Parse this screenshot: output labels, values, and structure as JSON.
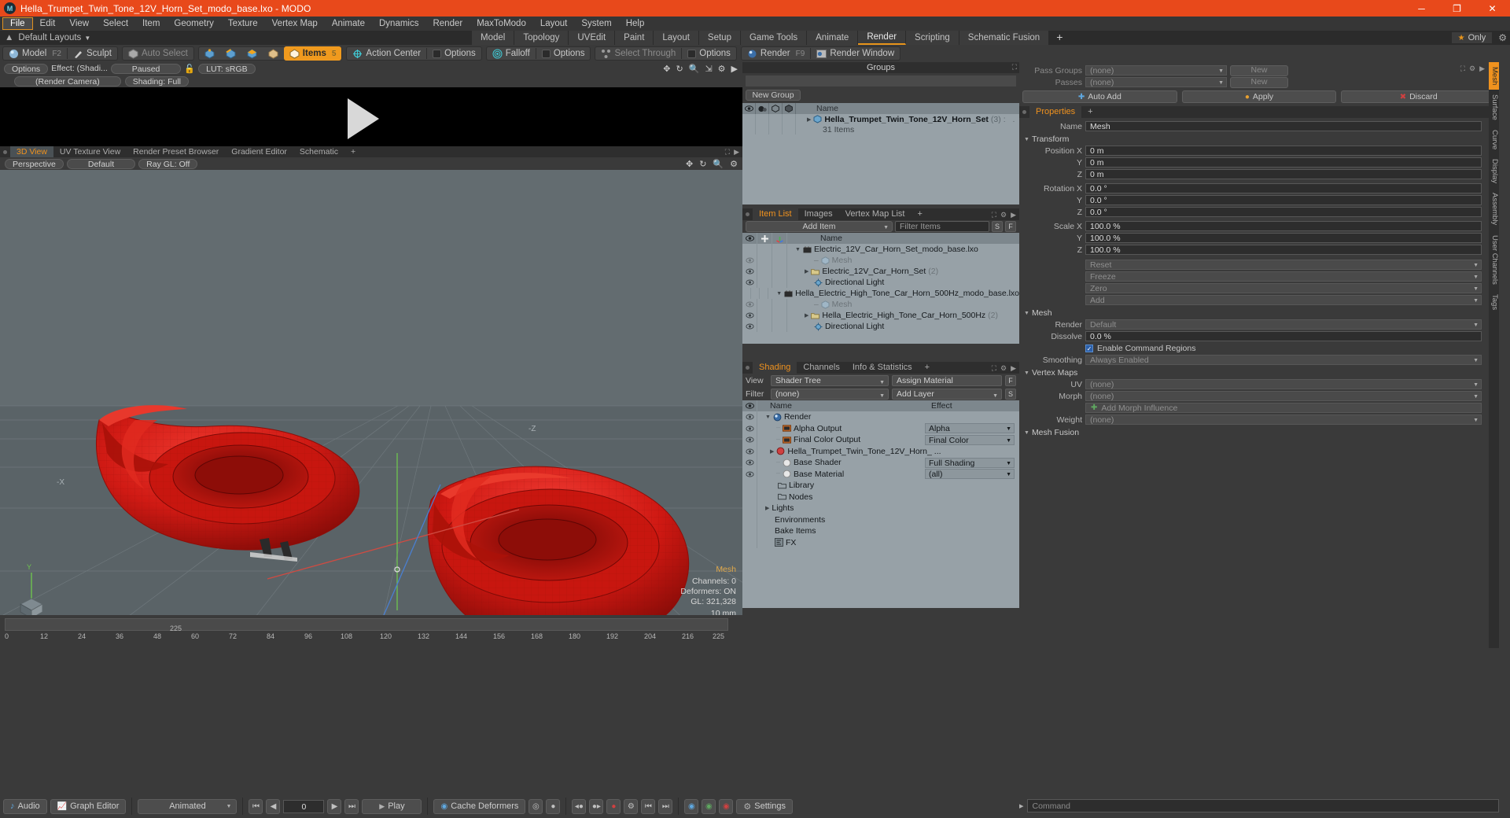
{
  "titlebar": {
    "title": "Hella_Trumpet_Twin_Tone_12V_Horn_Set_modo_base.lxo - MODO",
    "minimize": "─",
    "maximize": "❐",
    "close": "✕"
  },
  "menubar": {
    "items": [
      "File",
      "Edit",
      "View",
      "Select",
      "Item",
      "Geometry",
      "Texture",
      "Vertex Map",
      "Animate",
      "Dynamics",
      "Render",
      "MaxToModo",
      "Layout",
      "System",
      "Help"
    ],
    "active": "File"
  },
  "layoutbar": {
    "layouts_label": "Default Layouts",
    "tabs": [
      "Model",
      "Topology",
      "UVEdit",
      "Paint",
      "Layout",
      "Setup",
      "Game Tools",
      "Animate",
      "Render",
      "Scripting",
      "Schematic Fusion"
    ],
    "active_tab": "Render",
    "plus": "+",
    "only_label": "Only"
  },
  "modebar": {
    "model": "Model",
    "model_key": "F2",
    "sculpt": "Sculpt",
    "auto_select": "Auto Select",
    "items": "Items",
    "items_key": "5",
    "action_center": "Action Center",
    "options1": "Options",
    "falloff": "Falloff",
    "options2": "Options",
    "select_through": "Select Through",
    "options3": "Options",
    "render": "Render",
    "render_key": "F9",
    "render_window": "Render Window"
  },
  "render_view": {
    "options": "Options",
    "effect": "Effect: (Shadi...",
    "paused": "Paused",
    "lut": "LUT: sRGB",
    "camera": "(Render Camera)",
    "shading": "Shading: Full"
  },
  "view3d": {
    "tabs": [
      "3D View",
      "UV Texture View",
      "Render Preset Browser",
      "Gradient Editor",
      "Schematic"
    ],
    "active_tab": "3D View",
    "plus": "+",
    "perspective": "Perspective",
    "default": "Default",
    "raygl": "Ray GL: Off",
    "hud": {
      "title": "Mesh",
      "channels": "Channels: 0",
      "deformers": "Deformers: ON",
      "gl": "GL: 321,328",
      "unit": "10 mm"
    },
    "axis_labels": {
      "x": "-X",
      "y": "Y",
      "z": "-Z"
    }
  },
  "groups": {
    "title": "Groups",
    "new_group": "New Group",
    "columns": [
      "Name"
    ],
    "rows": [
      {
        "name": "Hella_Trumpet_Twin_Tone_12V_Horn_Set",
        "count": "(3)",
        "suffix": ":",
        "bold": true
      },
      {
        "name": "31 Items",
        "count": "",
        "suffix": "",
        "bold": false
      }
    ]
  },
  "itemlist": {
    "tabs": [
      "Item List",
      "Images",
      "Vertex Map List"
    ],
    "active_tab": "Item List",
    "plus": "+",
    "add_item": "Add Item",
    "filter_placeholder": "Filter Items",
    "btn_s": "S",
    "btn_f": "F",
    "columns": [
      "Name"
    ],
    "rows": [
      {
        "label": "Electric_12V_Car_Horn_Set_modo_base.lxo",
        "indent": 0,
        "icon": "scene-icon",
        "muted": false,
        "caret": "down"
      },
      {
        "label": "Mesh",
        "indent": 1,
        "icon": "mesh-icon",
        "muted": true,
        "caret": "none"
      },
      {
        "label": "Electric_12V_Car_Horn_Set",
        "indent": 1,
        "icon": "group-icon",
        "muted": false,
        "caret": "right",
        "count": "(2)"
      },
      {
        "label": "Directional Light",
        "indent": 1,
        "icon": "light-icon",
        "muted": false,
        "caret": "none"
      },
      {
        "label": "Hella_Electric_High_Tone_Car_Horn_500Hz_modo_base.lxo",
        "indent": 0,
        "icon": "scene-icon",
        "muted": false,
        "caret": "down"
      },
      {
        "label": "Mesh",
        "indent": 1,
        "icon": "mesh-icon",
        "muted": true,
        "caret": "none"
      },
      {
        "label": "Hella_Electric_High_Tone_Car_Horn_500Hz",
        "indent": 1,
        "icon": "group-icon",
        "muted": false,
        "caret": "right",
        "count": "(2)"
      },
      {
        "label": "Directional Light",
        "indent": 1,
        "icon": "light-icon",
        "muted": false,
        "caret": "none"
      }
    ]
  },
  "shading": {
    "tabs": [
      "Shading",
      "Channels",
      "Info & Statistics"
    ],
    "active_tab": "Shading",
    "plus": "+",
    "view_label": "View",
    "view_value": "Shader Tree",
    "assign_material": "Assign Material",
    "btn_f": "F",
    "filter_label": "Filter",
    "filter_value": "(none)",
    "add_layer": "Add Layer",
    "btn_s": "S",
    "col_name": "Name",
    "col_effect": "Effect",
    "rows": [
      {
        "label": "Render",
        "indent": 0,
        "effect": "",
        "icon": "render-icon",
        "caret": "down",
        "eye": true
      },
      {
        "label": "Alpha Output",
        "indent": 1,
        "effect": "Alpha",
        "icon": "output-icon",
        "caret": "none",
        "eye": true
      },
      {
        "label": "Final Color Output",
        "indent": 1,
        "effect": "Final Color",
        "icon": "output-icon",
        "caret": "none",
        "eye": true
      },
      {
        "label": "Hella_Trumpet_Twin_Tone_12V_Horn_ ...",
        "indent": 1,
        "effect": "",
        "icon": "material-icon",
        "caret": "right",
        "eye": true,
        "dotcolor": "#d04040"
      },
      {
        "label": "Base Shader",
        "indent": 1,
        "effect": "Full Shading",
        "icon": "shader-icon",
        "caret": "none",
        "eye": true
      },
      {
        "label": "Base Material",
        "indent": 1,
        "effect": "(all)",
        "icon": "shader-icon",
        "caret": "none",
        "eye": true
      },
      {
        "label": "Library",
        "indent": 1,
        "effect": "",
        "icon": "folder-icon",
        "caret": "none",
        "eye": false
      },
      {
        "label": "Nodes",
        "indent": 1,
        "effect": "",
        "icon": "folder-icon",
        "caret": "none",
        "eye": false
      },
      {
        "label": "Lights",
        "indent": 0,
        "effect": "",
        "icon": "none",
        "caret": "right",
        "eye": false
      },
      {
        "label": "Environments",
        "indent": 0,
        "effect": "",
        "icon": "none",
        "caret": "none",
        "eye": false
      },
      {
        "label": "Bake Items",
        "indent": 0,
        "effect": "",
        "icon": "none",
        "caret": "none",
        "eye": false
      },
      {
        "label": "FX",
        "indent": 0,
        "effect": "",
        "icon": "fx-icon",
        "caret": "none",
        "eye": false
      }
    ]
  },
  "properties": {
    "pass_groups_label": "Pass Groups",
    "pass_groups_value": "(none)",
    "new_btn": "New",
    "passes_label": "Passes",
    "passes_value": "(none)",
    "new_btn2": "New",
    "auto_add": "Auto Add",
    "apply": "Apply",
    "discard": "Discard",
    "tab_properties": "Properties",
    "plus": "+",
    "name_label": "Name",
    "name_value": "Mesh",
    "transform_label": "Transform",
    "position_label": "Position X",
    "position": [
      "0 m",
      "0 m",
      "0 m"
    ],
    "rotation_label": "Rotation X",
    "rotation": [
      "0.0 °",
      "0.0 °",
      "0.0 °"
    ],
    "scale_label": "Scale X",
    "scale": [
      "100.0 %",
      "100.0 %",
      "100.0 %"
    ],
    "axis_y": "Y",
    "axis_z": "Z",
    "reset": "Reset",
    "freeze": "Freeze",
    "zero": "Zero",
    "add": "Add",
    "mesh_label": "Mesh",
    "render_label": "Render",
    "render_value": "Default",
    "dissolve_label": "Dissolve",
    "dissolve_value": "0.0 %",
    "enable_command_regions": "Enable Command Regions",
    "smoothing_label": "Smoothing",
    "smoothing_value": "Always Enabled",
    "vertex_maps_label": "Vertex Maps",
    "uv_label": "UV",
    "uv_value": "(none)",
    "morph_label": "Morph",
    "morph_value": "(none)",
    "add_morph_influence": "Add Morph Influence",
    "weight_label": "Weight",
    "weight_value": "(none)",
    "mesh_fusion_label": "Mesh Fusion",
    "vtabs": [
      "Mesh",
      "Surface",
      "Curve",
      "Display",
      "Assembly",
      "User Channels",
      "Tags"
    ],
    "vtab_active": "Mesh"
  },
  "timeline": {
    "ticks": [
      "0",
      "12",
      "24",
      "36",
      "48",
      "60",
      "72",
      "84",
      "96",
      "108",
      "120",
      "132",
      "144",
      "156",
      "168",
      "180",
      "192",
      "204",
      "216"
    ],
    "center_label": "225",
    "end_label": "225"
  },
  "bottombar": {
    "audio": "Audio",
    "graph_editor": "Graph Editor",
    "animated": "Animated",
    "frame_value": "0",
    "play": "Play",
    "cache_deformers": "Cache Deformers",
    "settings": "Settings",
    "command_placeholder": "Command"
  },
  "colors": {
    "accent": "#f0921e",
    "title_bar": "#e8491b",
    "panel_bg": "#3a3a3a",
    "tree_bg": "#97a1a7",
    "tree_header": "#7d878d",
    "model_red": "#cc1111"
  }
}
